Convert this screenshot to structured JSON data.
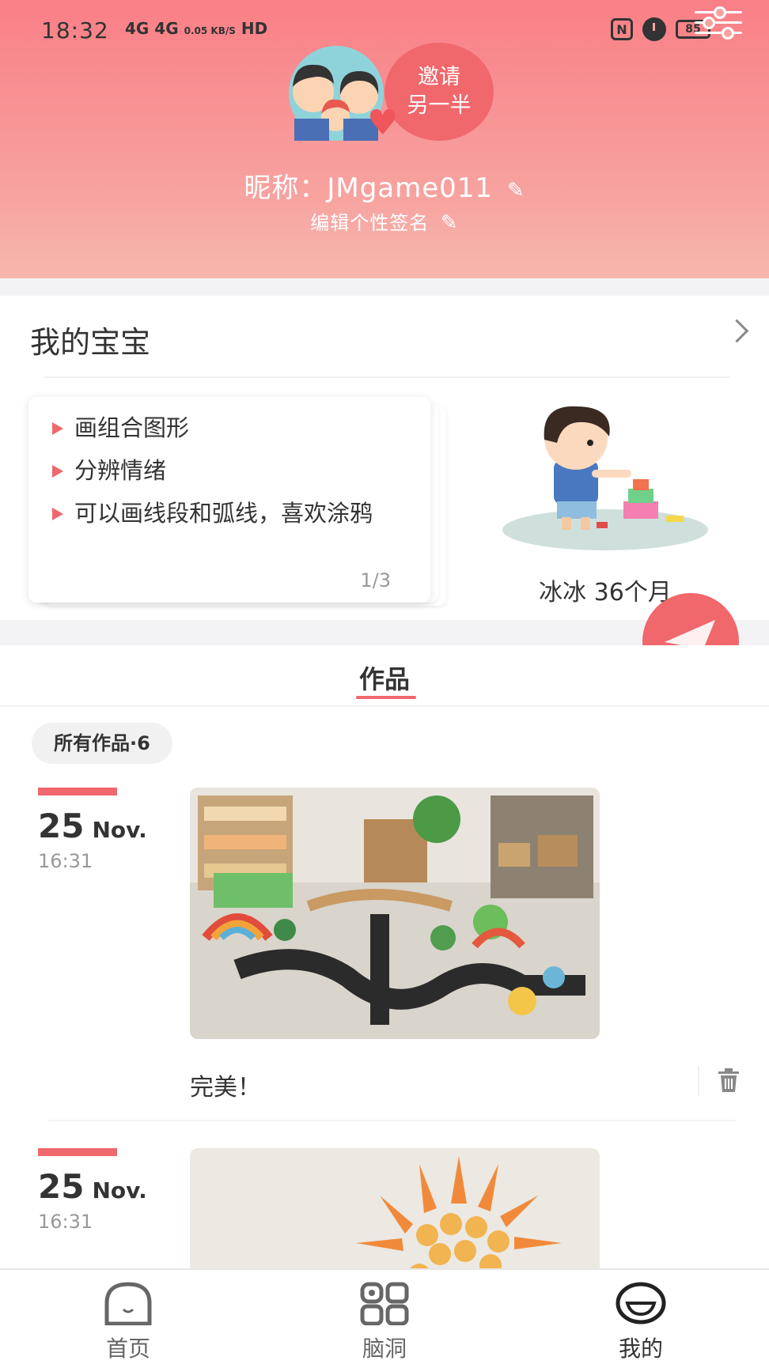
{
  "status_bar": {
    "time": "18:32",
    "network": "4G 4G",
    "speed": "0.05 KB/S",
    "hd": "HD",
    "battery": "85"
  },
  "profile": {
    "invite_line1": "邀请",
    "invite_line2": "另一半",
    "nickname": "昵称：JMgame011",
    "signature": "编辑个性签名"
  },
  "baby_section": {
    "title": "我的宝宝",
    "tips": [
      "画组合图形",
      "分辨情绪",
      "可以画线段和弧线，喜欢涂鸦"
    ],
    "tips_page": "1/3",
    "baby_name_age": "冰冰 36个月"
  },
  "works": {
    "tab_label": "作品",
    "filter_chip": "所有作品·6",
    "entries": [
      {
        "day": "25",
        "month": "Nov.",
        "time": "16:31",
        "caption": "完美！"
      },
      {
        "day": "25",
        "month": "Nov.",
        "time": "16:31",
        "caption": ""
      }
    ]
  },
  "bottom_nav": {
    "items": [
      {
        "label": "首页",
        "icon": "home-ghost-icon"
      },
      {
        "label": "脑洞",
        "icon": "grid-apps-icon"
      },
      {
        "label": "我的",
        "icon": "smiley-profile-icon"
      }
    ],
    "active": "我的"
  },
  "colors": {
    "accent": "#f0676c",
    "header_top": "#f97f86",
    "header_bottom": "#f6b7ad"
  }
}
